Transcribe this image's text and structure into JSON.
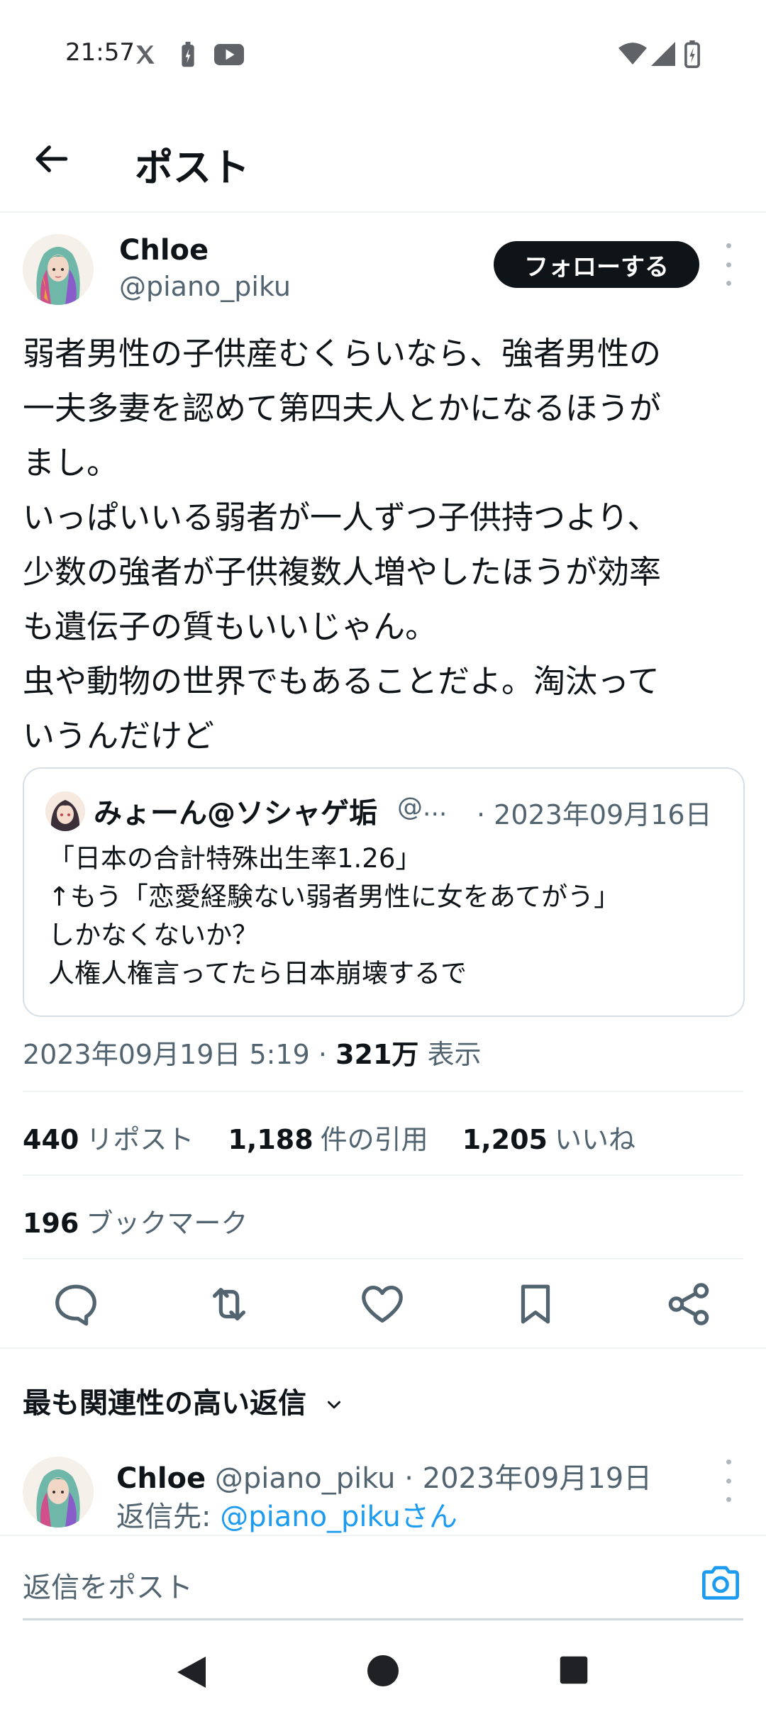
{
  "status_bar": {
    "time": "21:57"
  },
  "header": {
    "title": "ポスト"
  },
  "author": {
    "name": "Chloe",
    "handle": "@piano_piku",
    "follow_label": "フォローする"
  },
  "post": {
    "lines": [
      "弱者男性の子供産むくらいなら、強者男性の",
      "一夫多妻を認めて第四夫人とかになるほうが",
      "まし。",
      "いっぱいいる弱者が一人ずつ子供持つより、",
      "少数の強者が子供複数人増やしたほうが効率",
      "も遺伝子の質もいいじゃん。",
      "虫や動物の世界でもあることだよ。淘汰って",
      "いうんだけど"
    ]
  },
  "quote": {
    "name": "みょーん@ソシャゲ垢",
    "handle": "@...",
    "date": "· 2023年09月16日",
    "lines": [
      "「日本の合計特殊出生率1.26」",
      "↑もう「恋愛経験ない弱者男性に女をあてがう」",
      "しかなくないか？",
      "人権人権言ってたら日本崩壊するで"
    ]
  },
  "meta": {
    "timestamp": "2023年09月19日 5:19 · ",
    "views_count": "321万",
    "views_label": "表示"
  },
  "stats": {
    "reposts_count": "440",
    "reposts_label": "リポスト",
    "quotes_count": "1,188",
    "quotes_label": "件の引用",
    "likes_count": "1,205",
    "likes_label": "いいね",
    "bookmarks_count": "196",
    "bookmarks_label": "ブックマーク"
  },
  "replies": {
    "sort_label": "最も関連性の高い返信",
    "first": {
      "name": "Chloe",
      "handle_date": " @piano_piku · 2023年09月19日",
      "reply_to_prefix": "返信先: ",
      "reply_to_handle": "@piano_pikuさん"
    }
  },
  "composer": {
    "placeholder": "返信をポスト"
  },
  "colors": {
    "accent": "#1d9bf0",
    "text": "#0f1419",
    "muted": "#536471"
  }
}
